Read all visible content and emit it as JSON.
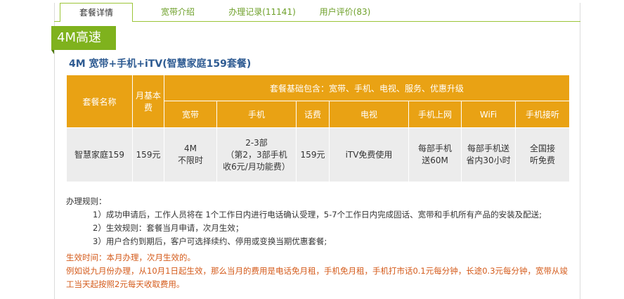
{
  "tabs": [
    {
      "label": "套餐详情"
    },
    {
      "label": "宽带介绍"
    },
    {
      "label": "办理记录(11141)"
    },
    {
      "label": "用户评价(83)"
    }
  ],
  "badge": "4M高速",
  "plan_title": "4M 宽带+手机+iTV(智慧家庭159套餐)",
  "table": {
    "h_name": "套餐名称",
    "h_fee": "月基本费",
    "h_group": "套餐基础包含：宽带、手机、电视、服务、优惠升级",
    "sub_headers": [
      "宽带",
      "手机",
      "话费",
      "电视",
      "手机上网",
      "WiFi",
      "手机接听"
    ],
    "row": {
      "name": "智慧家庭159",
      "fee": "159元",
      "broadband": "4M\n不限时",
      "phone": "2-3部\n（第2，3部手机\n收6元/月功能费）",
      "calls": "159元",
      "tv": "iTV免费使用",
      "mobile_data": "每部手机\n送60M",
      "wifi": "每部手机送\n省内30小时",
      "answer": "全国接\n听免费"
    }
  },
  "rules": {
    "title": "办理规则：",
    "items": [
      "1）成功申请后，工作人员将在 1个工作日内进行电话确认受理，5-7个工作日内完成固话、宽带和手机所有产品的安装及配送;",
      "2）生效规则：套餐当月申请，次月生效；",
      "3）用户合约到期后，客户可选择续约、停用或变换当期优惠套餐;"
    ]
  },
  "note": {
    "line1": "生效时间：本月办理，次月生效的。",
    "line2": "例如说九月份办理，从10月1日起生效，那么当月的费用是电话免月租，手机免月租，手机打市话0.1元每分钟，长途0.3元每分钟，宽带从竣工当天起按照2元每天收取费用。"
  },
  "colors": {
    "green": "#7fb21d",
    "tab_text": "#6ea02a",
    "header_orange": "#e9a214",
    "title_blue": "#2e5b92",
    "note_orange": "#d45a1a"
  }
}
